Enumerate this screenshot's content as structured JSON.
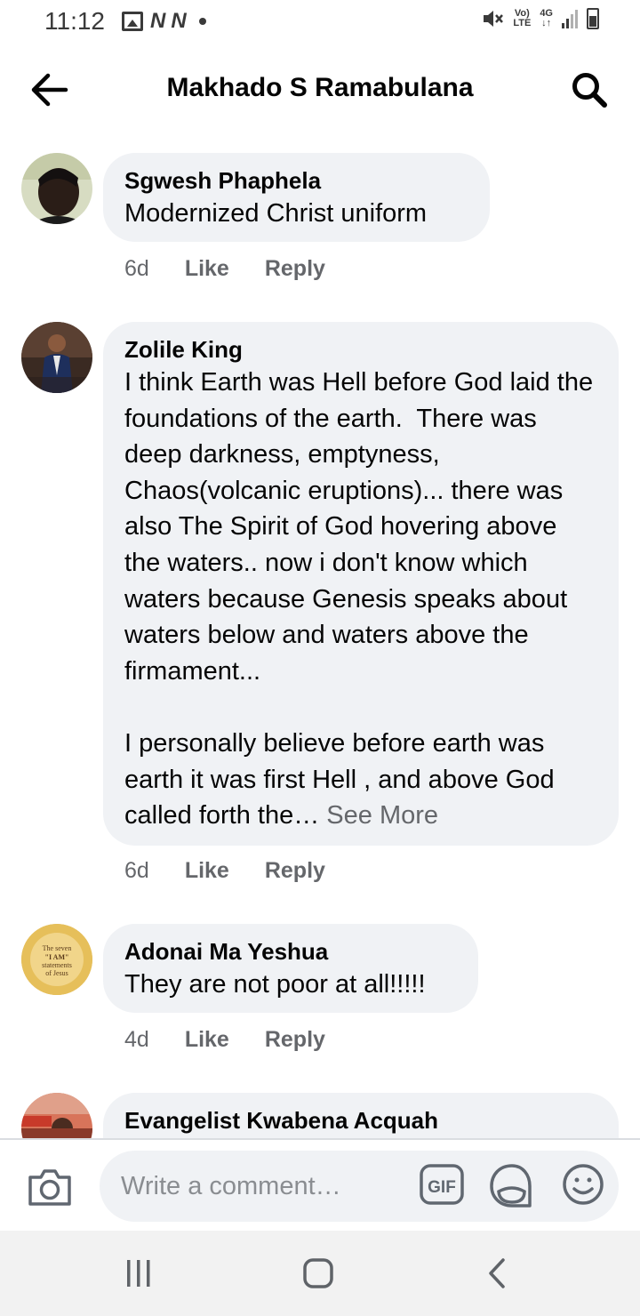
{
  "status_bar": {
    "time": "11:12",
    "volte_top": "Vo)",
    "volte_bottom": "LTE",
    "network_top": "4G",
    "network_bottom": "↓↑",
    "icons": [
      "image-icon",
      "n-icon",
      "n-icon",
      "dot-icon",
      "mute-icon",
      "volte-icon",
      "network-4g-icon",
      "signal-icon",
      "battery-icon"
    ]
  },
  "header": {
    "title": "Makhado S Ramabulana",
    "back_icon": "arrow-left-icon",
    "search_icon": "search-icon"
  },
  "comments": [
    {
      "author": "Sgwesh Phaphela",
      "text": "Modernized Christ uniform",
      "time": "6d",
      "like": "Like",
      "reply": "Reply"
    },
    {
      "author": "Zolile King",
      "text": "I think Earth was Hell before God laid the foundations of the earth.  There was deep darkness, emptyness, Chaos(volcanic eruptions)... there was also The Spirit of God hovering above the waters.. now i don't know which waters because Genesis speaks about waters below and waters above the firmament...\n\nI personally believe before earth was earth it was first Hell , and above God called forth the… ",
      "see_more": "See More",
      "time": "6d",
      "like": "Like",
      "reply": "Reply"
    },
    {
      "author": "Adonai Ma Yeshua",
      "text": "They are not poor at all!!!!!",
      "time": "4d",
      "like": "Like",
      "reply": "Reply",
      "avatar_lines": [
        "The seven",
        "\"I AM\"",
        "statements",
        "of Jesus"
      ]
    },
    {
      "author": "Evangelist Kwabena Acquah"
    }
  ],
  "composer": {
    "placeholder": "Write a comment…",
    "gif_label": "GIF",
    "icons": [
      "camera-icon",
      "gif-icon",
      "sticker-icon",
      "emoji-icon"
    ]
  },
  "nav_bar": {
    "icons": [
      "recent-apps-icon",
      "home-icon",
      "back-icon"
    ]
  },
  "colors": {
    "bubble": "#f0f2f5",
    "meta_text": "#65676b",
    "primary_text": "#050505"
  }
}
